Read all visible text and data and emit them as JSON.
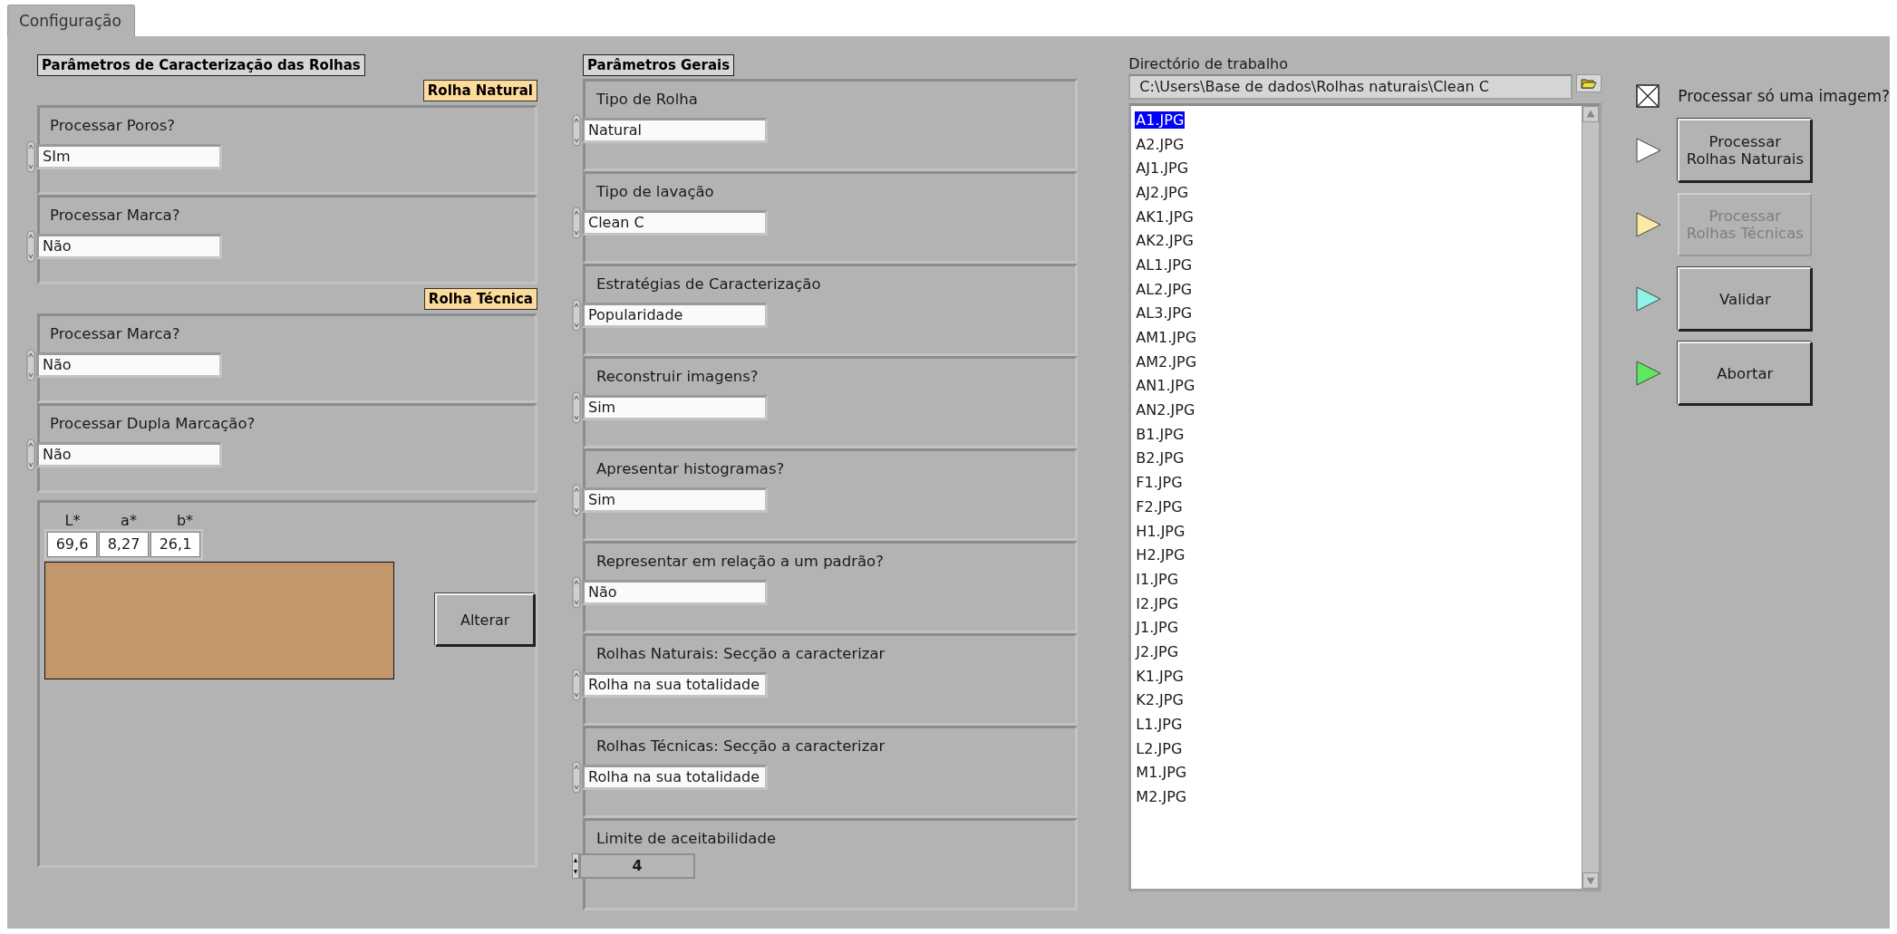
{
  "tabs": [
    {
      "label": "Configuração",
      "selected": true
    }
  ],
  "caracterizacao": {
    "title": "Parâmetros de Caracterização das Rolhas",
    "sections": [
      {
        "badge": "Rolha Natural",
        "fields": [
          {
            "label": "Processar Poros?",
            "value": "SIm"
          },
          {
            "label": "Processar Marca?",
            "value": "Não"
          }
        ]
      },
      {
        "badge": "Rolha Técnica",
        "fields": [
          {
            "label": "Processar Marca?",
            "value": "Não"
          },
          {
            "label": "Processar Dupla Marcação?",
            "value": "Não"
          }
        ]
      }
    ],
    "lab": {
      "columns": [
        {
          "label": "L*",
          "value": "69,6"
        },
        {
          "label": "a*",
          "value": "8,27"
        },
        {
          "label": "b*",
          "value": "26,1"
        }
      ],
      "color": "#c1976b",
      "button": "Alterar"
    }
  },
  "gerais": {
    "title": "Parâmetros Gerais",
    "fields": [
      {
        "label": "Tipo de Rolha",
        "value": "Natural",
        "kind": "ring"
      },
      {
        "label": "Tipo de lavação",
        "value": "Clean C",
        "kind": "ring"
      },
      {
        "label": "Estratégias de Caracterização",
        "value": "Popularidade",
        "kind": "ring"
      },
      {
        "label": "Reconstruir imagens?",
        "value": "Sim",
        "kind": "ring"
      },
      {
        "label": "Apresentar histogramas?",
        "value": "Sim",
        "kind": "ring"
      },
      {
        "label": "Representar em relação a um padrão?",
        "value": "Não",
        "kind": "ring"
      },
      {
        "label": "Rolhas Naturais: Secção a caracterizar",
        "value": "Rolha na sua totalidade",
        "kind": "ring"
      },
      {
        "label": "Rolhas Técnicas: Secção a caracterizar",
        "value": "Rolha na sua totalidade",
        "kind": "ring"
      },
      {
        "label": "Limite de aceitabilidade",
        "value": "4",
        "kind": "numeric"
      }
    ]
  },
  "directory": {
    "label": "Directório de trabalho",
    "path": "C:\\Users\\Base de dados\\Rolhas naturais\\Clean C",
    "files": [
      {
        "name": "A1.JPG",
        "selected": true
      },
      {
        "name": "A2.JPG",
        "selected": false
      },
      {
        "name": "AJ1.JPG",
        "selected": false
      },
      {
        "name": "AJ2.JPG",
        "selected": false
      },
      {
        "name": "AK1.JPG",
        "selected": false
      },
      {
        "name": "AK2.JPG",
        "selected": false
      },
      {
        "name": "AL1.JPG",
        "selected": false
      },
      {
        "name": "AL2.JPG",
        "selected": false
      },
      {
        "name": "AL3.JPG",
        "selected": false
      },
      {
        "name": "AM1.JPG",
        "selected": false
      },
      {
        "name": "AM2.JPG",
        "selected": false
      },
      {
        "name": "AN1.JPG",
        "selected": false
      },
      {
        "name": "AN2.JPG",
        "selected": false
      },
      {
        "name": "B1.JPG",
        "selected": false
      },
      {
        "name": "B2.JPG",
        "selected": false
      },
      {
        "name": "F1.JPG",
        "selected": false
      },
      {
        "name": "F2.JPG",
        "selected": false
      },
      {
        "name": "H1.JPG",
        "selected": false
      },
      {
        "name": "H2.JPG",
        "selected": false
      },
      {
        "name": "I1.JPG",
        "selected": false
      },
      {
        "name": "I2.JPG",
        "selected": false
      },
      {
        "name": "J1.JPG",
        "selected": false
      },
      {
        "name": "J2.JPG",
        "selected": false
      },
      {
        "name": "K1.JPG",
        "selected": false
      },
      {
        "name": "K2.JPG",
        "selected": false
      },
      {
        "name": "L1.JPG",
        "selected": false
      },
      {
        "name": "L2.JPG",
        "selected": false
      },
      {
        "name": "M1.JPG",
        "selected": false
      },
      {
        "name": "M2.JPG",
        "selected": false
      }
    ]
  },
  "single_image": {
    "label": "Processar só uma imagem?",
    "checked": true
  },
  "actions": [
    {
      "lines": [
        "Processar",
        "Rolhas Naturais"
      ],
      "color": "#ffffff",
      "disabled": false
    },
    {
      "lines": [
        "Processar",
        "Rolhas Técnicas"
      ],
      "color": "#fbeaa6",
      "disabled": true
    },
    {
      "lines": [
        "Validar"
      ],
      "color": "#8ff2e4",
      "disabled": false
    },
    {
      "lines": [
        "Abortar"
      ],
      "color": "#5ee85e",
      "disabled": false
    }
  ]
}
